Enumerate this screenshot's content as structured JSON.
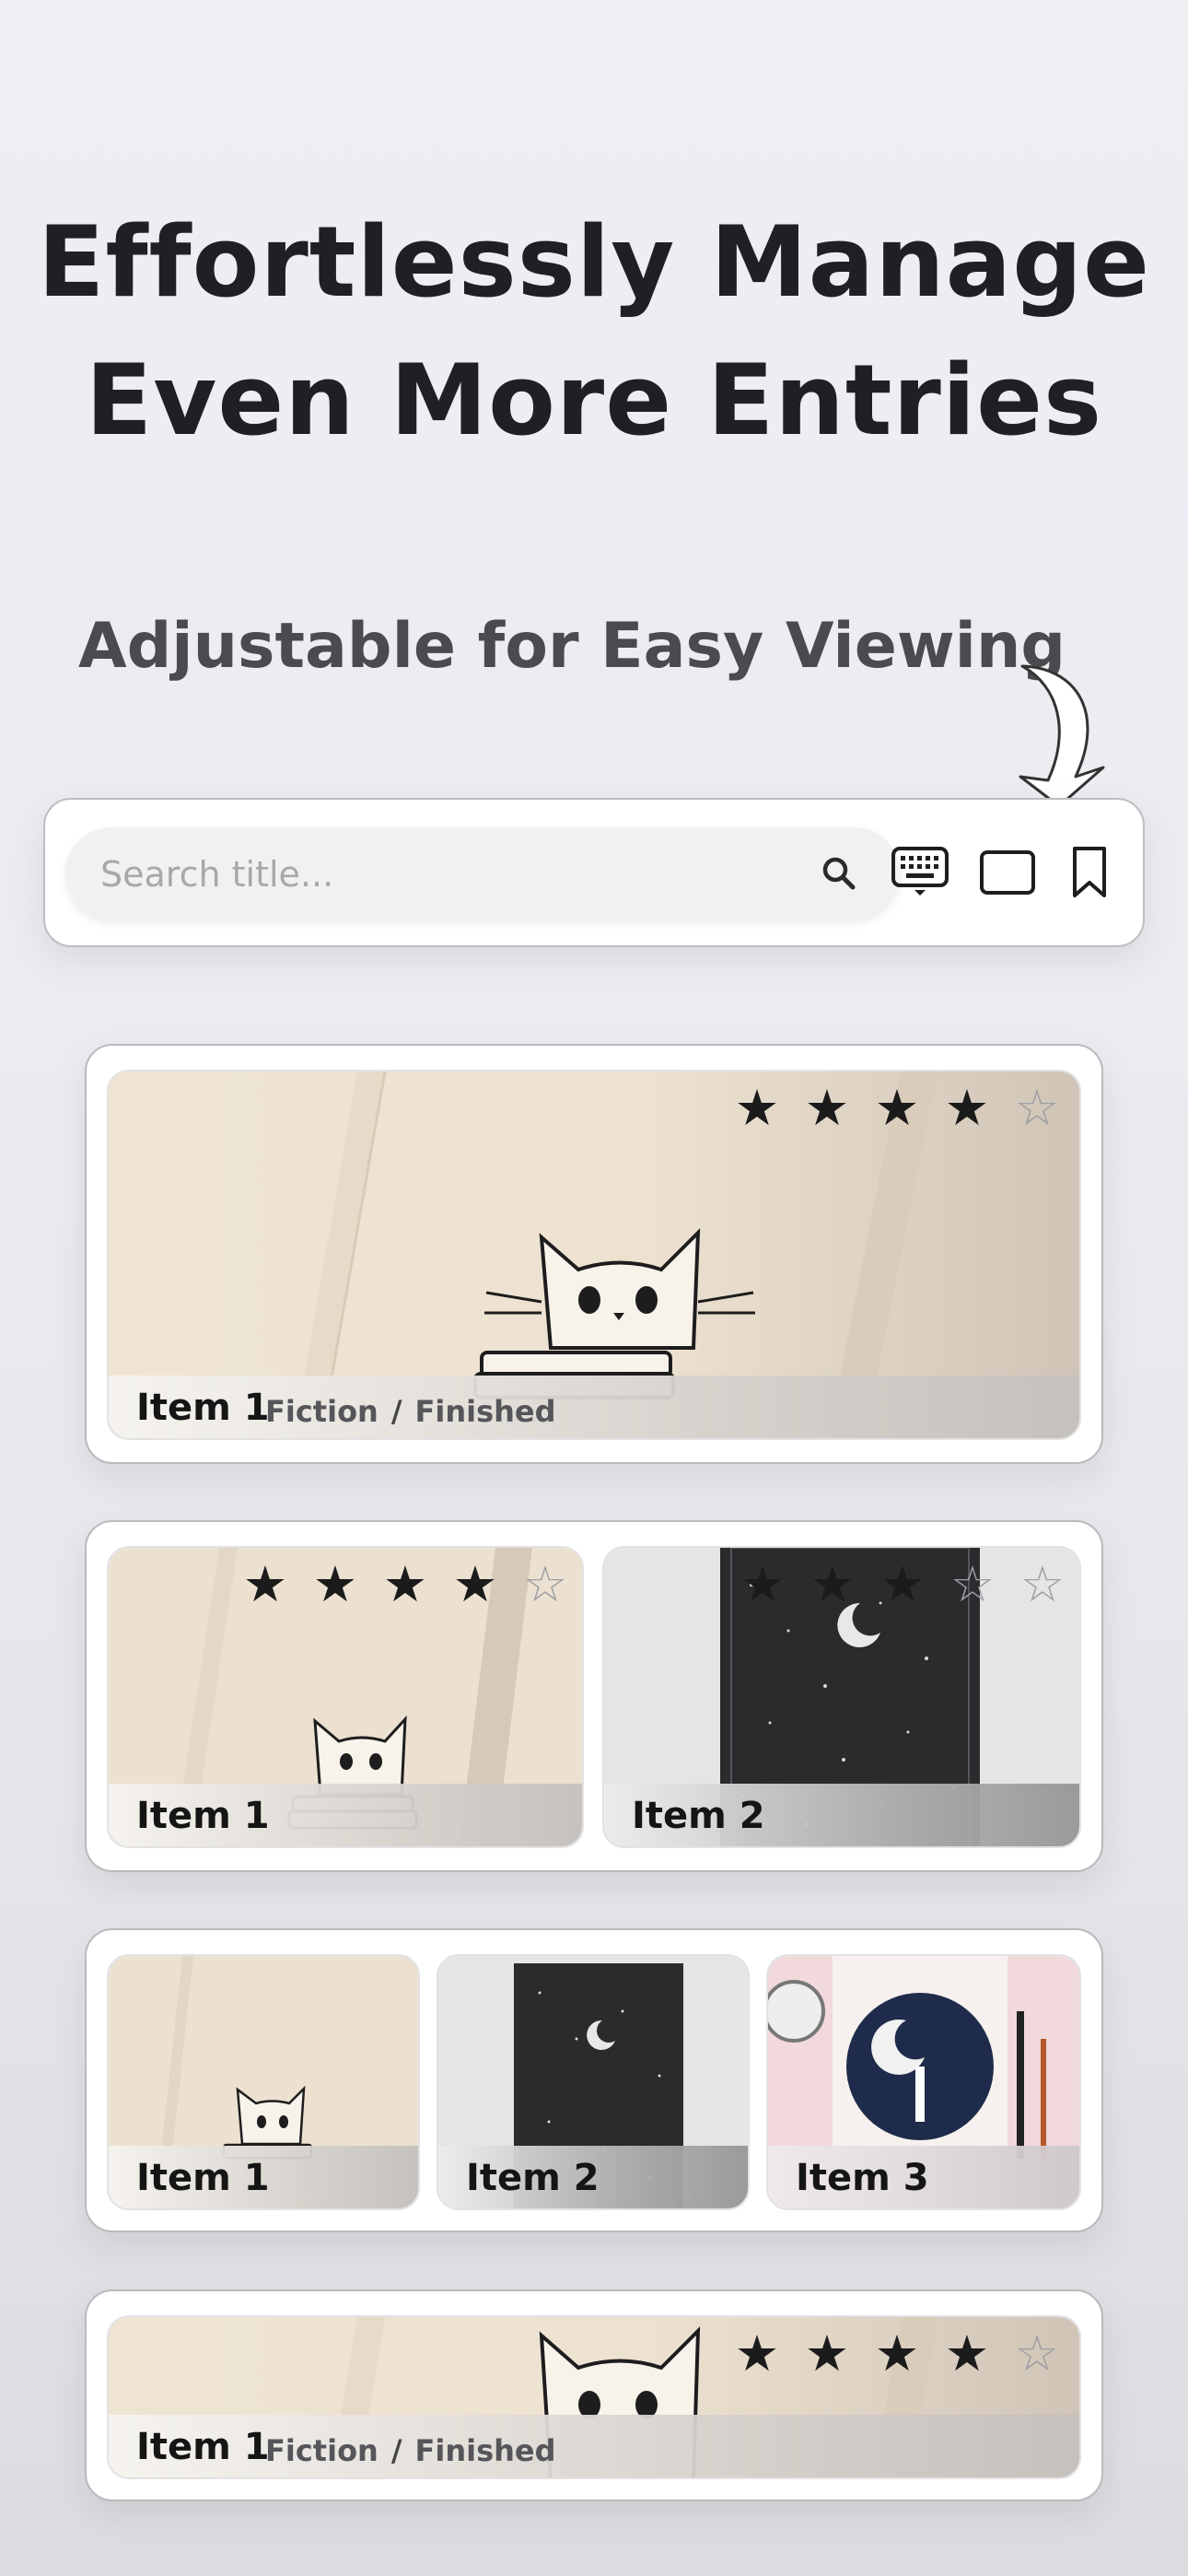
{
  "headline": {
    "line1": "Effortlessly Manage",
    "line2": "Even More Entries"
  },
  "subheadline": "Adjustable for Easy Viewing",
  "toolbar": {
    "search_placeholder": "Search title...",
    "icons": [
      "search-icon",
      "keyboard-icon",
      "single-column-layout-icon",
      "bookmark-icon"
    ]
  },
  "colors": {
    "text": "#202024",
    "star_filled": "#1b1b1b",
    "star_empty": "#9e9ea3"
  },
  "layouts": [
    {
      "columns": 1,
      "items": [
        {
          "title": "Item 1",
          "genre": "Fiction",
          "separator": "/",
          "status": "Finished",
          "rating": 4,
          "max_rating": 5
        }
      ]
    },
    {
      "columns": 2,
      "items": [
        {
          "title": "Item 1",
          "rating": 4,
          "max_rating": 5
        },
        {
          "title": "Item 2",
          "rating": 3,
          "max_rating": 5
        }
      ]
    },
    {
      "columns": 3,
      "items": [
        {
          "title": "Item 1"
        },
        {
          "title": "Item 2"
        },
        {
          "title": "Item 3"
        }
      ]
    },
    {
      "columns": 1,
      "items": [
        {
          "title": "Item 1",
          "genre": "Fiction",
          "separator": "/",
          "status": "Finished",
          "rating": 4,
          "max_rating": 5
        }
      ]
    }
  ]
}
